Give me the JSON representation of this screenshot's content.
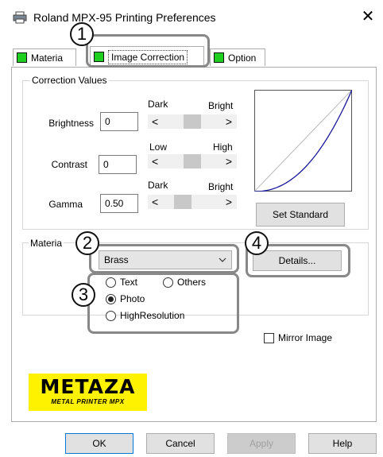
{
  "window": {
    "title": "Roland MPX-95 Printing Preferences",
    "close_glyph": "✕"
  },
  "tabs": [
    {
      "label": "Materia",
      "active": false
    },
    {
      "label": "Image Correction",
      "active": true
    },
    {
      "label": "Option",
      "active": false
    }
  ],
  "correction": {
    "group_label": "Correction Values",
    "brightness": {
      "label": "Brightness",
      "value": "0",
      "left_label": "Dark",
      "right_label": "Bright"
    },
    "contrast": {
      "label": "Contrast",
      "value": "0",
      "left_label": "Low",
      "right_label": "High"
    },
    "gamma": {
      "label": "Gamma",
      "value": "0.50",
      "left_label": "Dark",
      "right_label": "Bright"
    },
    "arrow_left": "<",
    "arrow_right": ">",
    "set_standard_label": "Set Standard"
  },
  "material": {
    "group_label": "Materia",
    "selected": "Brass",
    "details_label": "Details...",
    "modes": [
      {
        "label": "Text",
        "checked": false
      },
      {
        "label": "Others",
        "checked": false
      },
      {
        "label": "Photo",
        "checked": true
      },
      {
        "label": "HighResolution",
        "checked": false
      }
    ],
    "mirror_label": "Mirror Image",
    "mirror_checked": false
  },
  "callouts": [
    "1",
    "2",
    "3",
    "4"
  ],
  "logo": {
    "main": "METAZA",
    "sub": "METAL PRINTER MPX"
  },
  "buttons": {
    "ok": "OK",
    "cancel": "Cancel",
    "apply": "Apply",
    "help": "Help"
  },
  "colors": {
    "tab_marker": "#1fcf1f",
    "logo_bg": "#fff200",
    "curve": "#1a1a9c"
  }
}
